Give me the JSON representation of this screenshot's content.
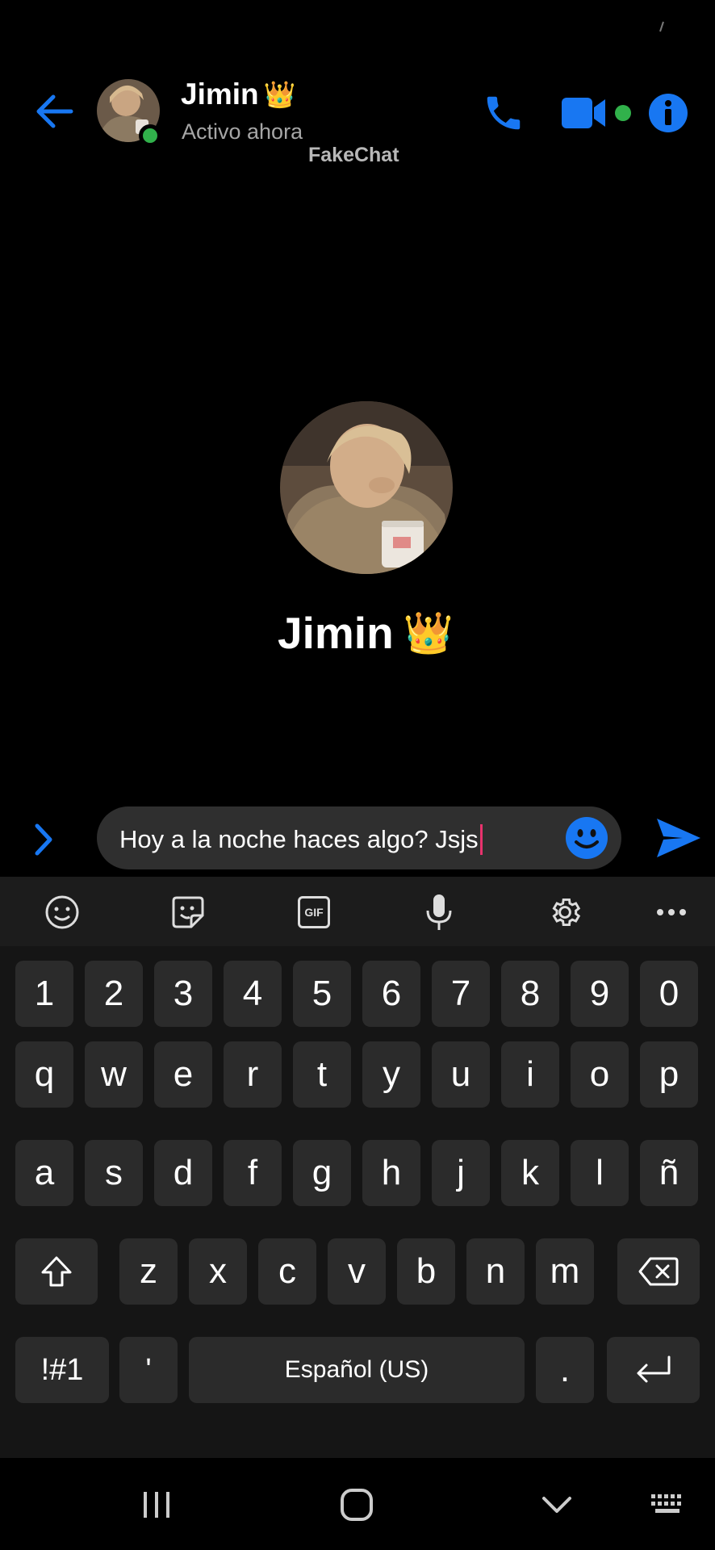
{
  "header": {
    "contact_name": "Jimin",
    "name_emoji": "👑",
    "status": "Activo ahora",
    "watermark": "FakeChat",
    "accent_color": "#1877f2",
    "online_color": "#31b14b"
  },
  "profile": {
    "name": "Jimin",
    "name_emoji": "👑"
  },
  "composer": {
    "message": "Hoy a la noche haces algo? Jsjs"
  },
  "keyboard": {
    "toolbar": [
      "emoji-icon",
      "sticker-icon",
      "gif-icon",
      "microphone-icon",
      "settings-icon",
      "more-icon"
    ],
    "gif_label": "GIF",
    "row_numbers": [
      "1",
      "2",
      "3",
      "4",
      "5",
      "6",
      "7",
      "8",
      "9",
      "0"
    ],
    "row_top": [
      "q",
      "w",
      "e",
      "r",
      "t",
      "y",
      "u",
      "i",
      "o",
      "p"
    ],
    "row_mid": [
      "a",
      "s",
      "d",
      "f",
      "g",
      "h",
      "j",
      "k",
      "l",
      "ñ"
    ],
    "row_bottom": [
      "z",
      "x",
      "c",
      "v",
      "b",
      "n",
      "m"
    ],
    "symbols_label": "!#1",
    "apostrophe_label": "'",
    "space_label": "Español (US)",
    "period_label": "."
  },
  "navbar": {
    "buttons": [
      "recent-apps-icon",
      "home-icon",
      "hide-keyboard-icon",
      "keyboard-switch-icon"
    ]
  }
}
